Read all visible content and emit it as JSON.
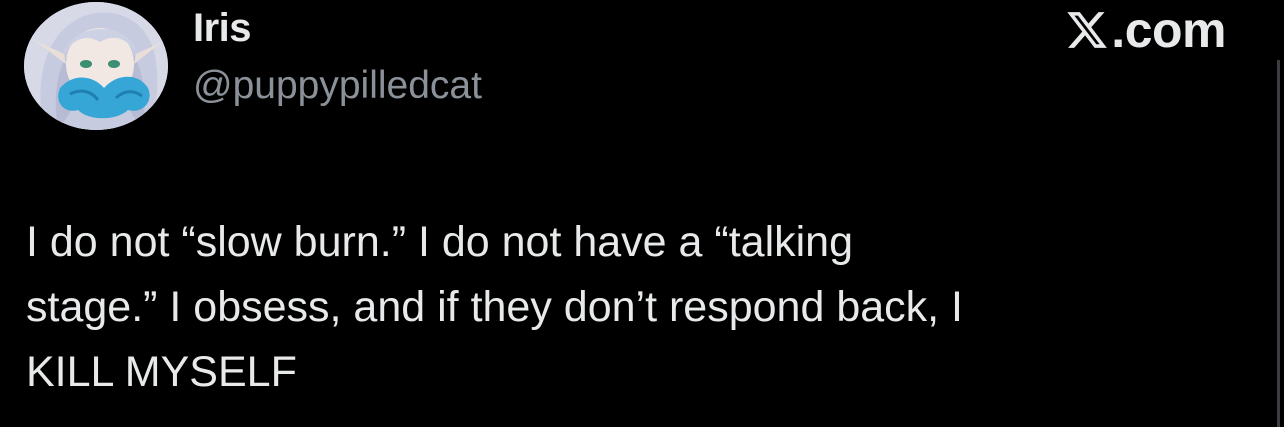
{
  "tweet": {
    "author": {
      "display_name": "Iris",
      "handle": "@puppypilledcat",
      "avatar": "anime-character-avatar"
    },
    "brand": {
      "icon": "x-logo-icon",
      "text": ".com"
    },
    "text": "I do not “slow burn.” I do not have a “talking\nstage.” I obsess, and if they don’t respond back, I\nKILL MYSELF"
  },
  "colors": {
    "background": "#000000",
    "primary_text": "#e7e9ea",
    "secondary_text": "#8b9198"
  }
}
